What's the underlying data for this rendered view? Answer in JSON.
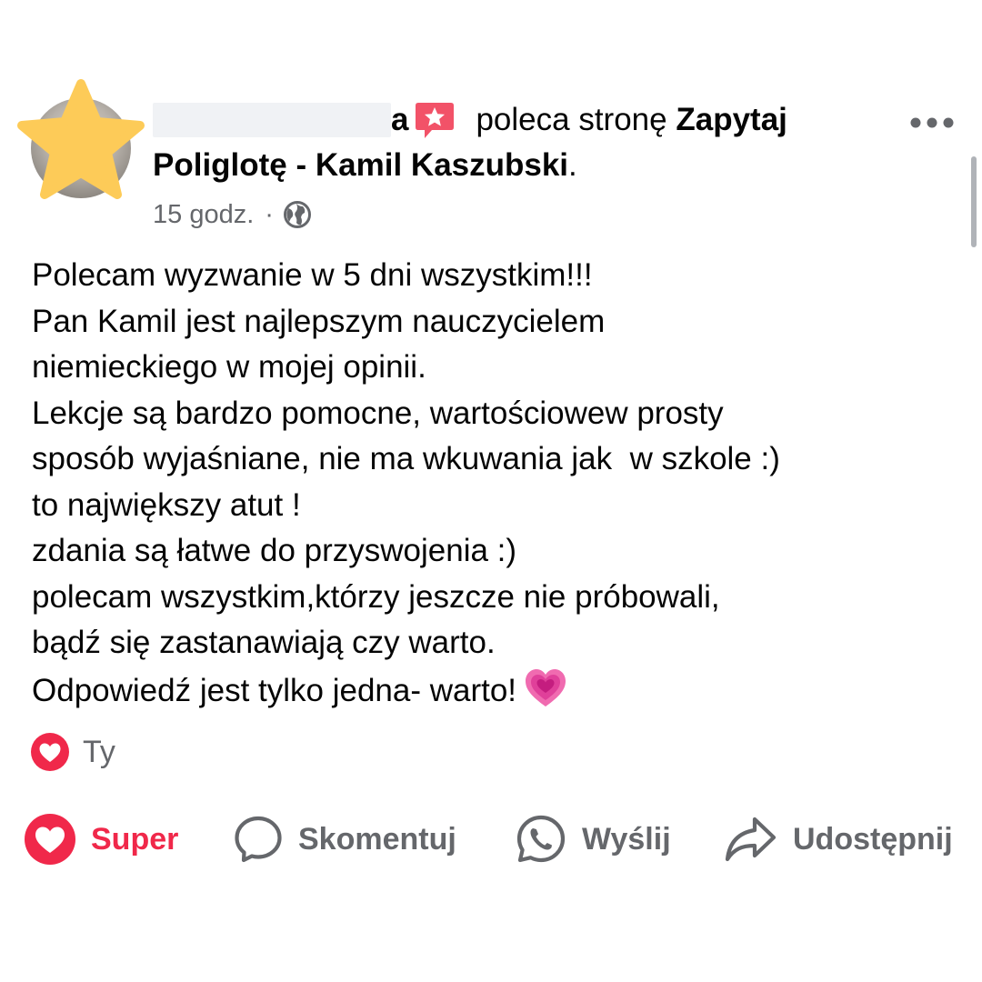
{
  "post": {
    "author": {
      "name_visible_suffix": "a",
      "verb": "poleca stronę",
      "page_name_part1": "Zapytaj",
      "page_name_part2": "Poliglotę - Kamil Kaszubski",
      "page_name_end": "."
    },
    "meta": {
      "time": "15 godz.",
      "separator": "·",
      "audience_icon": "globe-icon"
    },
    "more_icon": "more-horizontal-icon",
    "body_lines": [
      "Polecam wyzwanie w 5 dni wszystkim!!!",
      "Pan Kamil jest najlepszym nauczycielem",
      "niemieckiego w mojej opinii.",
      "Lekcje są bardzo pomocne, wartościowew prosty",
      "sposób wyjaśniane, nie ma wkuwania jak  w szkole :)",
      "to największy atut !",
      "zdania są łatwe do przyswojenia :)",
      "polecam wszystkim,którzy jeszcze nie próbowali,",
      "bądź się zastanawiają czy warto.",
      "Odpowiedź jest tylko jedna- warto!"
    ],
    "reactions": {
      "icon": "love-reaction-icon",
      "label": "Ty"
    },
    "actions": {
      "super": "Super",
      "comment": "Skomentuj",
      "send": "Wyślij",
      "share": "Udostępnij"
    },
    "colors": {
      "love_red": "#f0284a",
      "secondary_text": "#65676b",
      "primary_text": "#050505",
      "star_yellow": "#fdcb58",
      "recommend_badge": "#f25268"
    }
  }
}
